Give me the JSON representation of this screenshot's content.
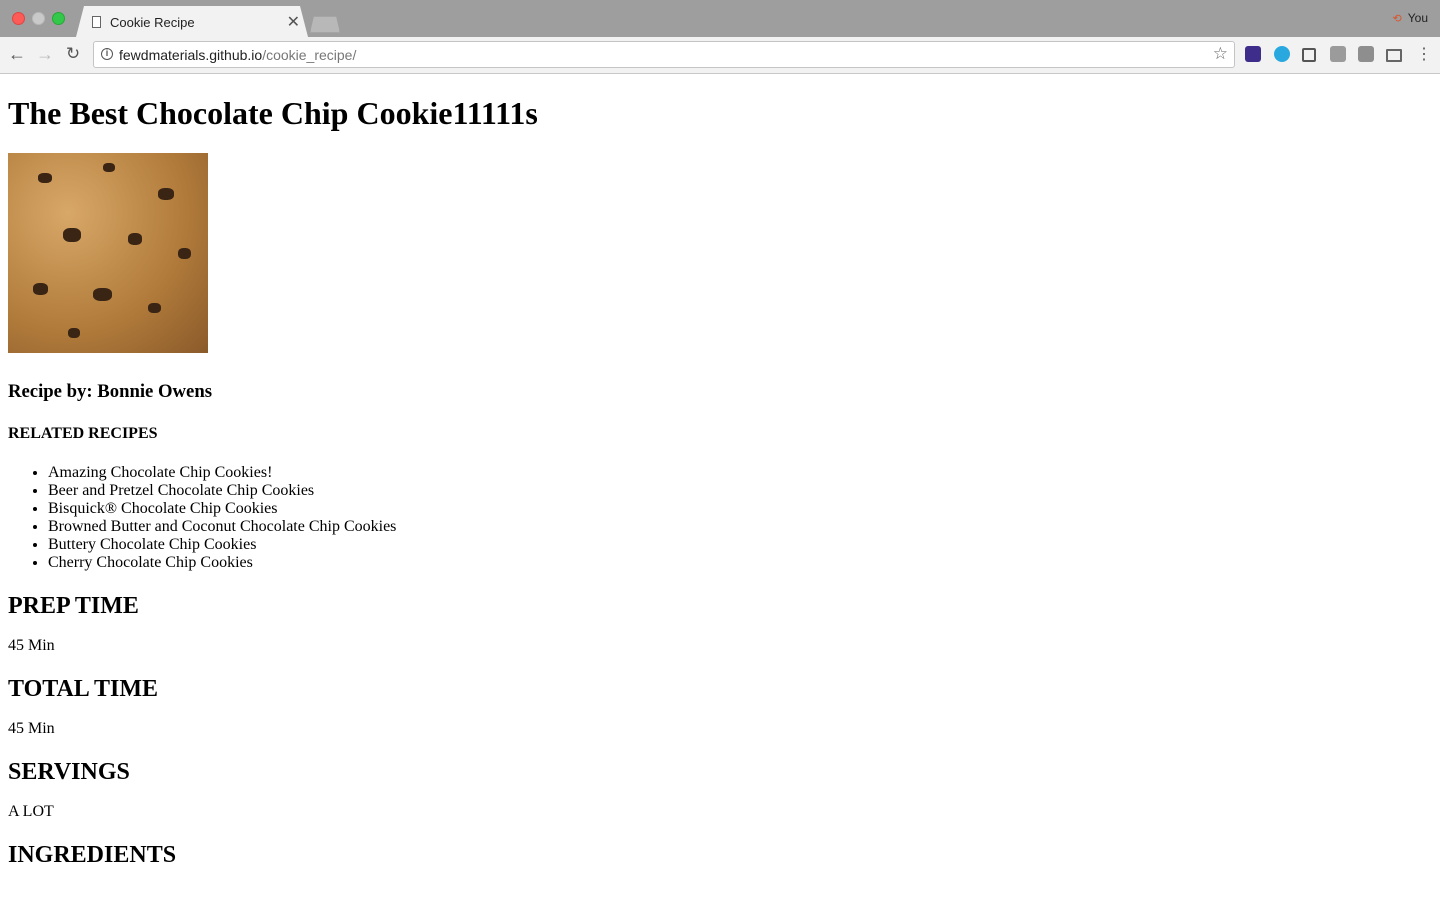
{
  "browser": {
    "tab_title": "Cookie Recipe",
    "profile_name": "You",
    "url_host": "fewdmaterials.github.io",
    "url_path": "/cookie_recipe/"
  },
  "page": {
    "title": "The Best Chocolate Chip Cookie11111s",
    "author": "Recipe by: Bonnie Owens",
    "related_heading": "RELATED RECIPES",
    "related": [
      "Amazing Chocolate Chip Cookies!",
      "Beer and Pretzel Chocolate Chip Cookies",
      "Bisquick® Chocolate Chip Cookies",
      "Browned Butter and Coconut Chocolate Chip Cookies",
      "Buttery Chocolate Chip Cookies",
      "Cherry Chocolate Chip Cookies"
    ],
    "prep_heading": "PREP TIME",
    "prep_value": "45 Min",
    "total_heading": "TOTAL TIME",
    "total_value": "45 Min",
    "servings_heading": "SERVINGS",
    "servings_value": "A LOT",
    "ingredients_heading": "INGREDIENTS"
  }
}
